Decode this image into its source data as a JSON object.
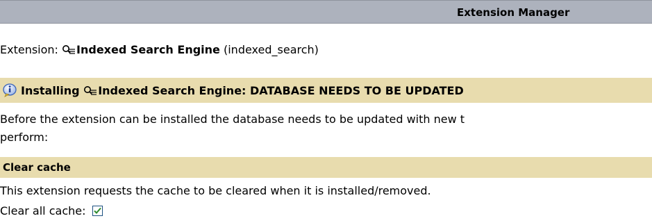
{
  "header": {
    "title": "Extension Manager"
  },
  "extension": {
    "label": "Extension:",
    "name": "Indexed Search Engine",
    "key": "(indexed_search)",
    "icon": "search-index-icon"
  },
  "install_notice": {
    "icon": "info-icon",
    "prefix": "Installing",
    "name": "Indexed Search Engine",
    "status": ": DATABASE NEEDS TO BE UPDATED"
  },
  "description": {
    "line1": "Before the extension can be installed the database needs to be updated with new t",
    "line2": "perform:"
  },
  "clear_cache": {
    "heading": "Clear cache",
    "message": "This extension requests the cache to be cleared when it is installed/removed.",
    "option_label": "Clear all cache:",
    "checked": true
  },
  "colors": {
    "header_bg": "#adb2bd",
    "band_bg": "#e8dcae",
    "checkbox_border": "#1c5180",
    "checkmark": "#2e8b2e"
  }
}
